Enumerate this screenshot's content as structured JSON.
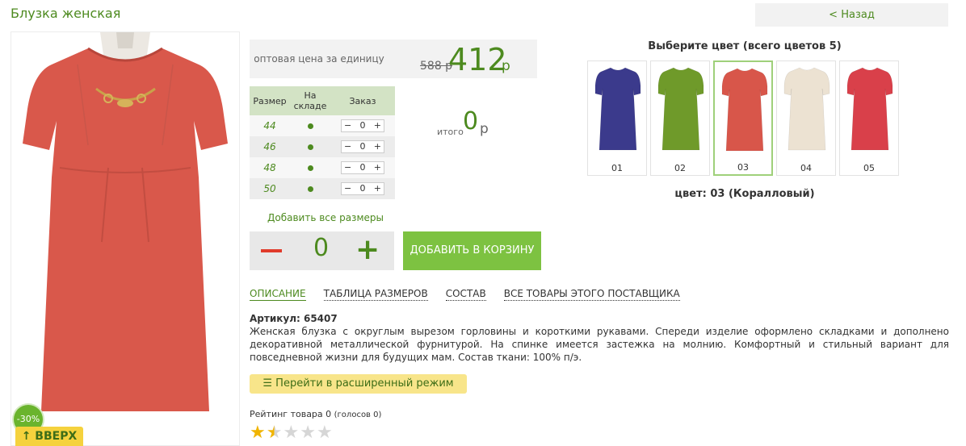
{
  "page": {
    "title": "Блузка женская",
    "back_label": "< Назад",
    "discount_badge": "-30%",
    "up_label": "↑ ВВЕРХ"
  },
  "price": {
    "label": "оптовая цена за единицу",
    "old": "588 р",
    "new": "412",
    "currency": "р"
  },
  "size_table": {
    "headers": [
      "Размер",
      "На складе",
      "Заказ"
    ],
    "rows": [
      {
        "size": "44",
        "qty": "0"
      },
      {
        "size": "46",
        "qty": "0"
      },
      {
        "size": "48",
        "qty": "0"
      },
      {
        "size": "50",
        "qty": "0"
      }
    ],
    "minus": "−",
    "plus": "+"
  },
  "total": {
    "label": "итого",
    "value": "0",
    "currency": "р"
  },
  "add_all_label": "Добавить все размеры",
  "quantity": {
    "value": "0",
    "plus": "+"
  },
  "cart_button": "ДОБАВИТЬ В КОРЗИНУ",
  "tabs": [
    {
      "label": "ОПИСАНИЕ",
      "active": true
    },
    {
      "label": "ТАБЛИЦА РАЗМЕРОВ",
      "active": false
    },
    {
      "label": "СОСТАВ",
      "active": false
    },
    {
      "label": "ВСЕ ТОВАРЫ ЭТОГО ПОСТАВЩИКА",
      "active": false
    }
  ],
  "article": "Артикул: 65407",
  "description": "Женская блузка с округлым вырезом горловины и короткими рукавами. Спереди изделие оформлено складками и дополнено декоративной металлической фурнитурой. На спинке  имеется застежка на молнию. Комфортный и стильный вариант для повседневной жизни для будущих мам. Состав ткани: 100% п/э.",
  "advanced_mode": "Перейти в расширенный режим",
  "rating": {
    "label": "Рейтинг товара 0",
    "votes": "(голосов 0)",
    "stars": 1.5
  },
  "colors": {
    "title": "Выберите цвет (всего цветов 5)",
    "items": [
      {
        "num": "01",
        "color": "#3b3a8c"
      },
      {
        "num": "02",
        "color": "#6f9a2a"
      },
      {
        "num": "03",
        "color": "#d8564a"
      },
      {
        "num": "04",
        "color": "#ece2d2"
      },
      {
        "num": "05",
        "color": "#d9404a"
      }
    ],
    "selected_index": 2,
    "selected_label": "цвет: 03 (Коралловый)"
  },
  "theme": {
    "accent": "#4d8a1f",
    "button_green": "#7dc241",
    "blouse": "#d9584b"
  }
}
